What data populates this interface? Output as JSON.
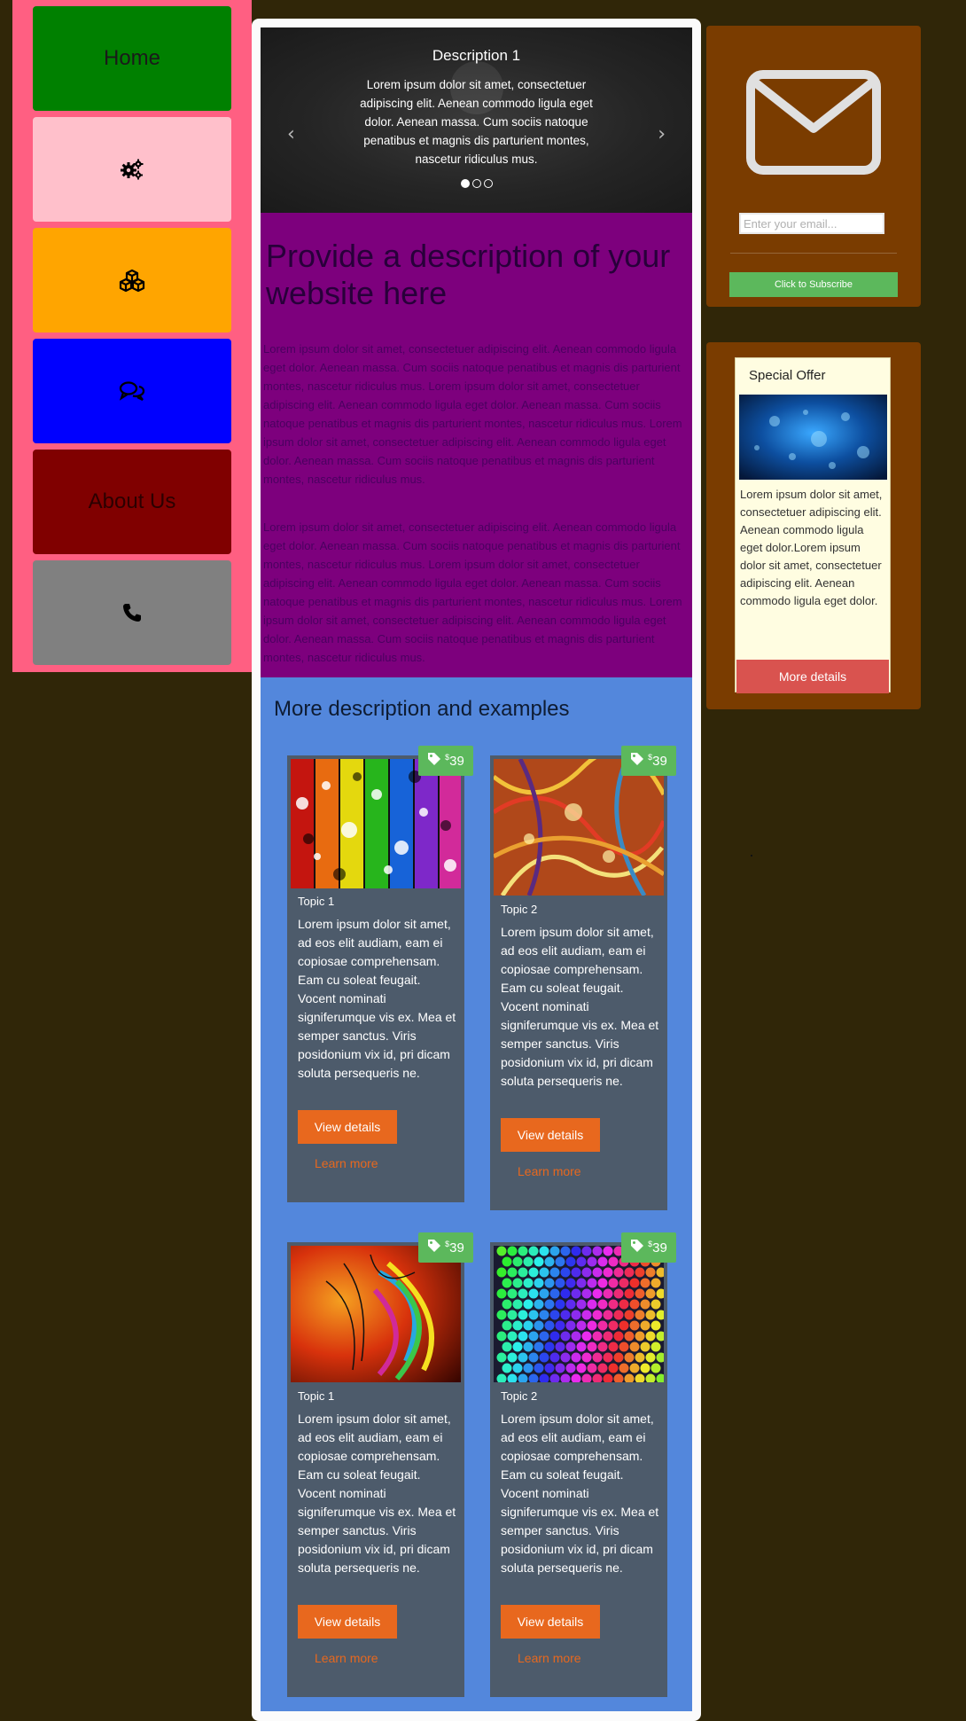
{
  "nav": {
    "items": [
      {
        "label": "Home",
        "icon": "",
        "color": "#008000"
      },
      {
        "label": "",
        "icon": "gears-icon",
        "color": "#ffc0cb"
      },
      {
        "label": "",
        "icon": "cubes-icon",
        "color": "#ffa500"
      },
      {
        "label": "",
        "icon": "chat-icon",
        "color": "#0000ff"
      },
      {
        "label": "About Us",
        "icon": "",
        "color": "#800000"
      },
      {
        "label": "",
        "icon": "phone-icon",
        "color": "#808080"
      }
    ]
  },
  "carousel": {
    "title": "Description 1",
    "text": "Lorem ipsum dolor sit amet, consectetuer adipiscing elit. Aenean commodo ligula eget dolor. Aenean massa. Cum sociis natoque penatibus et magnis dis parturient montes, nascetur ridiculus mus.",
    "prev": "‹",
    "next": "›",
    "slides": 3,
    "active_slide": 1
  },
  "intro": {
    "heading": "Provide a description of your website here",
    "paragraphs": [
      "Lorem ipsum dolor sit amet, consectetuer adipiscing elit. Aenean commodo ligula eget dolor. Aenean massa. Cum sociis natoque penatibus et magnis dis parturient montes, nascetur ridiculus mus. Lorem ipsum dolor sit amet, consectetuer adipiscing elit. Aenean commodo ligula eget dolor. Aenean massa. Cum sociis natoque penatibus et magnis dis parturient montes, nascetur ridiculus mus. Lorem ipsum dolor sit amet, consectetuer adipiscing elit. Aenean commodo ligula eget dolor. Aenean massa. Cum sociis natoque penatibus et magnis dis parturient montes, nascetur ridiculus mus.",
      "Lorem ipsum dolor sit amet, consectetuer adipiscing elit. Aenean commodo ligula eget dolor. Aenean massa. Cum sociis natoque penatibus et magnis dis parturient montes, nascetur ridiculus mus. Lorem ipsum dolor sit amet, consectetuer adipiscing elit. Aenean commodo ligula eget dolor. Aenean massa. Cum sociis natoque penatibus et magnis dis parturient montes, nascetur ridiculus mus. Lorem ipsum dolor sit amet, consectetuer adipiscing elit. Aenean commodo ligula eget dolor. Aenean massa. Cum sociis natoque penatibus et magnis dis parturient montes, nascetur ridiculus mus."
    ]
  },
  "examples": {
    "heading": "More description and examples",
    "cards": [
      {
        "price_symbol": "$",
        "price": "39",
        "topic": "Topic 1",
        "body": "Lorem ipsum dolor sit amet, ad eos elit audiam, eam ei copiosae comprehensam. Eam cu soleat feugait. Vocent nominati signiferumque vis ex. Mea et semper sanctus. Viris posidonium vix id, pri dicam soluta persequeris ne.",
        "view": "View details",
        "learn": "Learn more"
      },
      {
        "price_symbol": "$",
        "price": "39",
        "topic": "Topic 2",
        "body": "Lorem ipsum dolor sit amet, ad eos elit audiam, eam ei copiosae comprehensam. Eam cu soleat feugait. Vocent nominati signiferumque vis ex. Mea et semper sanctus. Viris posidonium vix id, pri dicam soluta persequeris ne.",
        "view": "View details",
        "learn": "Learn more"
      },
      {
        "price_symbol": "$",
        "price": "39",
        "topic": "Topic 1",
        "body": "Lorem ipsum dolor sit amet, ad eos elit audiam, eam ei copiosae comprehensam. Eam cu soleat feugait. Vocent nominati signiferumque vis ex. Mea et semper sanctus. Viris posidonium vix id, pri dicam soluta persequeris ne.",
        "view": "View details",
        "learn": "Learn more"
      },
      {
        "price_symbol": "$",
        "price": "39",
        "topic": "Topic 2",
        "body": "Lorem ipsum dolor sit amet, ad eos elit audiam, eam ei copiosae comprehensam. Eam cu soleat feugait. Vocent nominati signiferumque vis ex. Mea et semper sanctus. Viris posidonium vix id, pri dicam soluta persequeris ne.",
        "view": "View details",
        "learn": "Learn more"
      }
    ]
  },
  "subscribe": {
    "icon": "envelope-icon",
    "placeholder": "Enter your email...",
    "button": "Click to Subscribe"
  },
  "offer": {
    "title": "Special Offer",
    "text": "Lorem ipsum dolor sit amet, consectetuer adipiscing elit. Aenean commodo ligula eget dolor.Lorem ipsum dolor sit amet, consectetuer adipiscing elit. Aenean commodo ligula eget dolor.",
    "button": "More details"
  },
  "colors": {
    "page_bg": "#302608",
    "nav_bg": "#ff5f82",
    "intro_bg": "#7d007d",
    "examples_bg": "#5387dc",
    "card_bg": "#4d5b6b",
    "accent_orange": "#e8681e",
    "accent_green": "#5cb85c",
    "sidebar_brown": "#7a3c00",
    "offer_red": "#d9534f"
  }
}
